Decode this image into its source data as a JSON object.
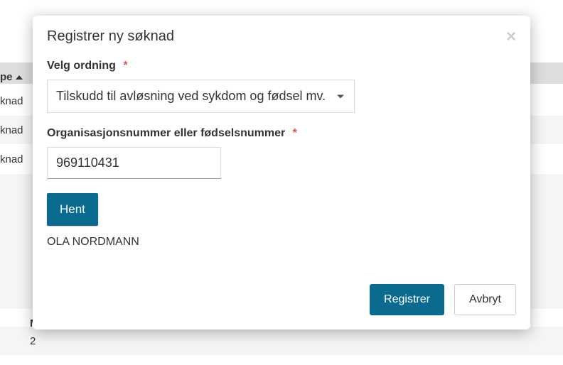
{
  "background": {
    "column_header": "pe",
    "rows": [
      "knad",
      "knad",
      "knad"
    ],
    "bottom_label": "M",
    "bottom_value": "2"
  },
  "modal": {
    "title": "Registrer ny søknad",
    "scheme": {
      "label": "Velg ordning",
      "selected": "Tilskudd til avløsning ved sykdom og fødsel mv."
    },
    "orgnr": {
      "label": "Organisasjonsnummer eller fødselsnummer",
      "value": "969110431"
    },
    "fetch_button": "Hent",
    "result_name": "OLA NORDMANN",
    "register_button": "Registrer",
    "cancel_button": "Avbryt"
  }
}
